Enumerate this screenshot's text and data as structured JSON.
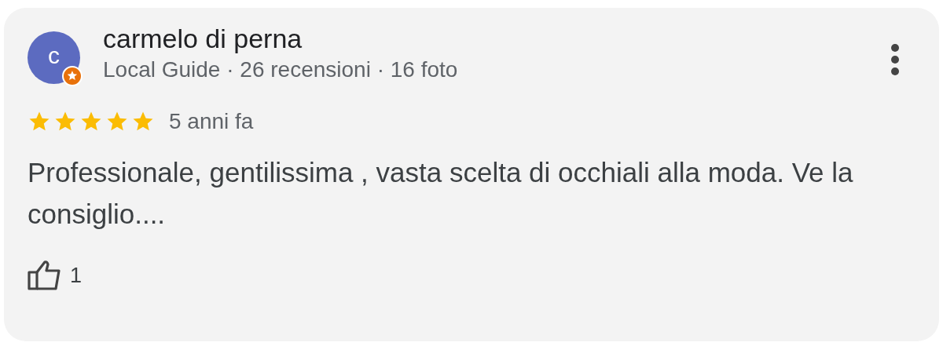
{
  "review": {
    "avatar_letter": "c",
    "local_guide": true,
    "author": "carmelo di perna",
    "meta": "Local Guide · 26 recensioni · 16 foto",
    "stars": 5,
    "time": "5 anni fa",
    "text": "Professionale, gentilissima , vasta scelta di occhiali alla moda. Ve la consiglio....",
    "likes": "1"
  }
}
